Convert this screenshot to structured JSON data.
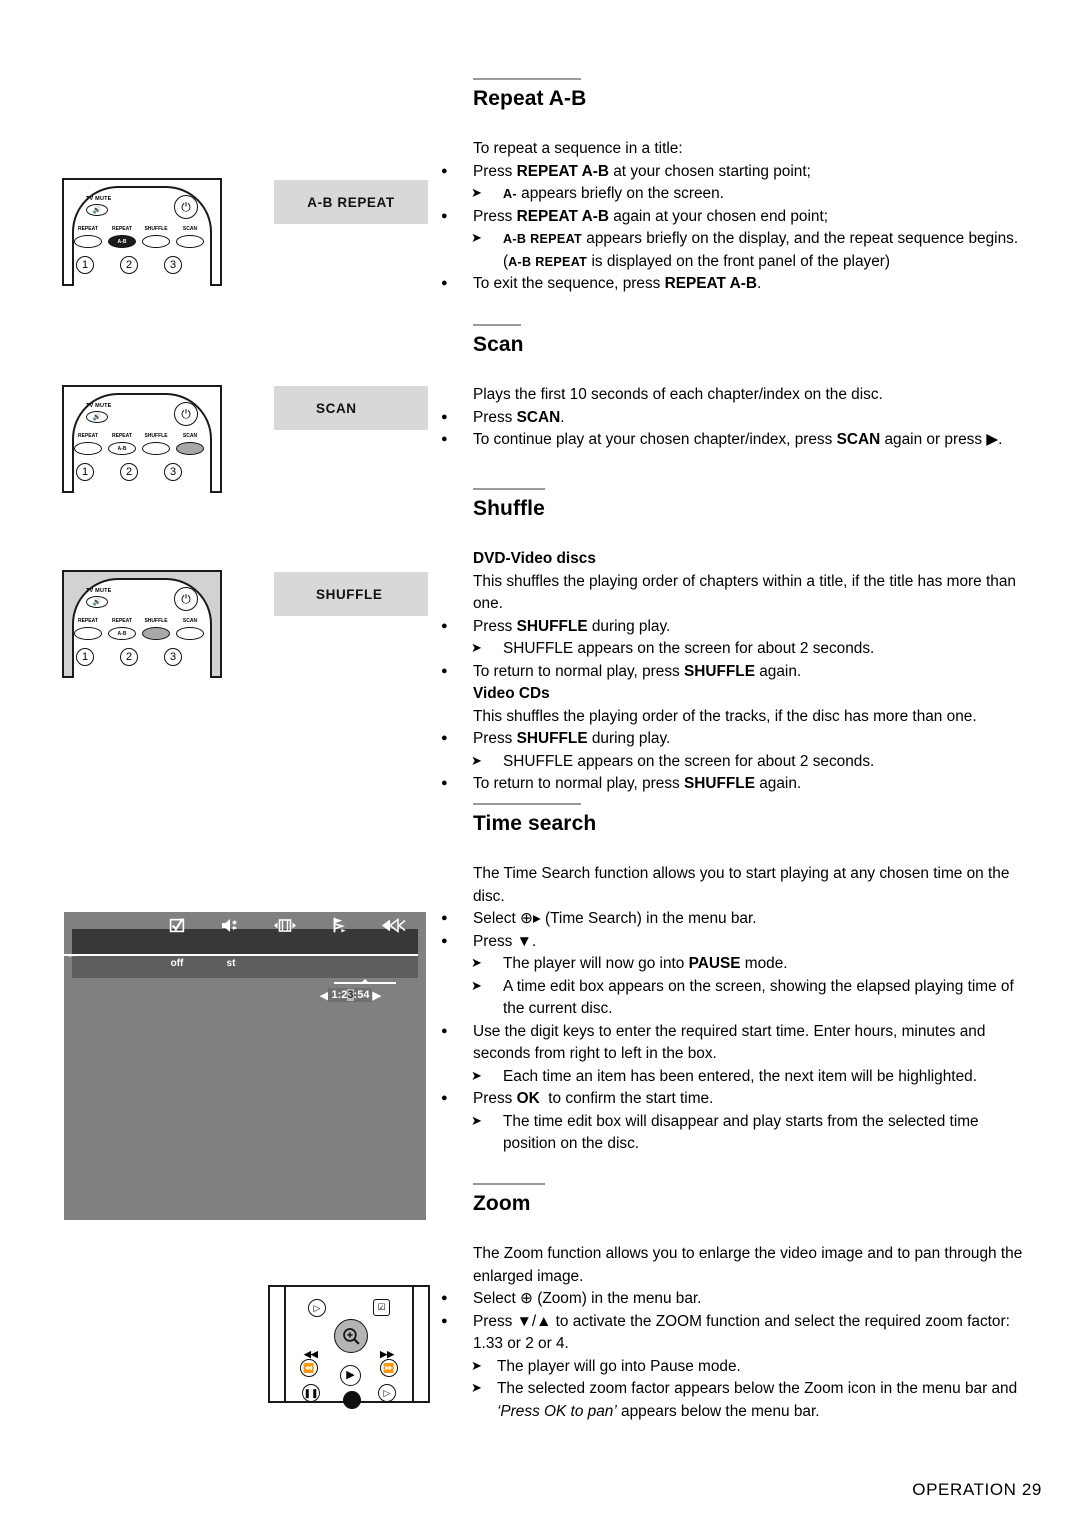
{
  "page": {
    "footer": "OPERATION 29"
  },
  "illustrations": {
    "remote_top": {
      "name": "remote-repeat-ab",
      "tv_mute_label": "TV MUTE",
      "keys": [
        {
          "label": "REPEAT",
          "state": "normal"
        },
        {
          "label": "REPEAT",
          "inner": "A-B",
          "state": "dark"
        },
        {
          "label": "SHUFFLE",
          "state": "normal"
        },
        {
          "label": "SCAN",
          "state": "normal"
        }
      ],
      "numbers": [
        "1",
        "2",
        "3"
      ]
    },
    "remote_scan": {
      "name": "remote-scan",
      "tv_mute_label": "TV MUTE",
      "keys": [
        {
          "label": "REPEAT",
          "state": "normal"
        },
        {
          "label": "REPEAT",
          "inner": "A-B",
          "state": "normal"
        },
        {
          "label": "SHUFFLE",
          "state": "normal"
        },
        {
          "label": "SCAN",
          "state": "highlight"
        }
      ],
      "numbers": [
        "1",
        "2",
        "3"
      ]
    },
    "remote_shuffle": {
      "name": "remote-shuffle",
      "tv_mute_label": "TV MUTE",
      "keys": [
        {
          "label": "REPEAT",
          "state": "normal"
        },
        {
          "label": "REPEAT",
          "inner": "A-B",
          "state": "normal"
        },
        {
          "label": "SHUFFLE",
          "state": "highlight"
        },
        {
          "label": "SCAN",
          "state": "normal"
        }
      ],
      "numbers": [
        "1",
        "2",
        "3"
      ]
    },
    "chips": {
      "ab_repeat": "A-B REPEAT",
      "scan": "SCAN",
      "shuffle": "SHUFFLE"
    },
    "osd": {
      "icons": [
        {
          "name": "subtitle-icon",
          "glyph": "☑"
        },
        {
          "name": "audio-language-icon",
          "glyph": "ὐA"
        },
        {
          "name": "screen-fit-icon",
          "glyph": "⇔"
        },
        {
          "name": "camera-angle-icon",
          "glyph": "⚑"
        },
        {
          "name": "scan-icon",
          "glyph": "«"
        },
        {
          "name": "time-search-icon",
          "glyph": "ὕ4"
        }
      ],
      "sub_values": [
        "off",
        "st"
      ],
      "time_value": "1:23:54",
      "time_digits": [
        "1",
        ":",
        "2",
        "3",
        ":",
        "5",
        "4"
      ],
      "selected_digit_index": 3,
      "left_arrow": "◀",
      "right_arrow": "▶"
    },
    "remote_zoom": {
      "name": "remote-zoom",
      "zoom_button": "zoom-magnifier-button",
      "keys": [
        "slow-icon",
        "subtitle-icon",
        "rewind-icon",
        "forward-icon",
        "prev-icon",
        "play-icon",
        "next-icon",
        "pause-icon",
        "stop-icon",
        "step-icon"
      ]
    }
  },
  "sections": [
    {
      "id": "repeat-ab",
      "title": "Repeat A-B",
      "intro": "To repeat a sequence in a title:",
      "items": [
        {
          "type": "dot",
          "html": "Press <b>REPEAT A-B</b> at your chosen starting point;"
        },
        {
          "type": "arrow",
          "html": "<span class='sc'>A-</span> appears briefly on the screen."
        },
        {
          "type": "dot",
          "html": "Press <b>REPEAT A-B</b> again at your chosen end point;"
        },
        {
          "type": "arrow",
          "html": "<span class='sc'>A-B REPEAT</span> appears briefly on the display, and the repeat sequence begins.(<span class='sc'>A-B REPEAT</span> is displayed on the front panel of the player)"
        },
        {
          "type": "dot",
          "html": "To exit the sequence, press <b>REPEAT A-B</b>."
        }
      ]
    },
    {
      "id": "scan",
      "title": "Scan",
      "intro": "Plays the first 10 seconds of each chapter/index on the disc.",
      "items": [
        {
          "type": "dot",
          "html": "Press <b>SCAN</b>."
        },
        {
          "type": "dot",
          "html": "To continue play at your chosen chapter/index, press <b>SCAN</b> again or press ▶."
        }
      ]
    },
    {
      "id": "shuffle",
      "title": "Shuffle",
      "sub1": "DVD-Video discs",
      "intro1": "This shuffles the playing order of chapters within a title, if the title has more than one.",
      "items1": [
        {
          "type": "dot",
          "html": "Press <b>SHUFFLE</b> during play."
        },
        {
          "type": "arrow",
          "html": "SHUFFLE appears on the screen for about 2 seconds."
        },
        {
          "type": "dot",
          "html": "To return to normal play, press <b>SHUFFLE</b> again."
        }
      ],
      "sub2": "Video CDs",
      "intro2": "This shuffles the playing order of the tracks, if the disc has more than one.",
      "items2": [
        {
          "type": "dot",
          "html": "Press <b>SHUFFLE</b> during play."
        },
        {
          "type": "arrow",
          "html": "SHUFFLE appears on the screen for about 2 seconds."
        },
        {
          "type": "dot",
          "html": "To return to normal play, press <b>SHUFFLE</b> again."
        }
      ]
    },
    {
      "id": "time-search",
      "title": "Time search",
      "intro": "The Time Search function allows you to start playing at any chosen time on the disc.",
      "items": [
        {
          "type": "dot",
          "html": "Select ⊕▸ (Time Search) in the menu bar."
        },
        {
          "type": "dot",
          "html": "Press ▼."
        },
        {
          "type": "arrow",
          "html": "The player will now go into <b>PAUSE</b> mode."
        },
        {
          "type": "arrow",
          "html": "A time edit box appears on the screen, showing the elapsed playing time of the current disc."
        },
        {
          "type": "dot",
          "html": "Use the digit keys to enter the required start time. Enter hours, minutes and seconds from right to left in the box."
        },
        {
          "type": "arrow",
          "html": "Each time an item has been entered, the next item will be highlighted."
        },
        {
          "type": "dot",
          "html": "Press <b>OK</b>&nbsp; to confirm the start time."
        },
        {
          "type": "arrow",
          "html": "The time edit box will disappear and play starts from the selected time position on the disc."
        }
      ]
    },
    {
      "id": "zoom",
      "title": "Zoom",
      "intro": "The Zoom function allows you to enlarge the video image and to pan through the enlarged image.",
      "items": [
        {
          "type": "dot",
          "html": "Select ⊕ (Zoom) in the menu bar."
        },
        {
          "type": "dot",
          "html": "Press ▼/▲ to activate the ZOOM function and select the required zoom factor: 1.33 or 2 or 4."
        },
        {
          "type": "arrow",
          "html": "The player will go into Pause mode."
        },
        {
          "type": "arrow",
          "html": "The selected zoom factor appears below the Zoom icon in the menu bar and <span class='ital'>‘Press OK to pan’</span> appears below the menu bar."
        }
      ]
    }
  ]
}
